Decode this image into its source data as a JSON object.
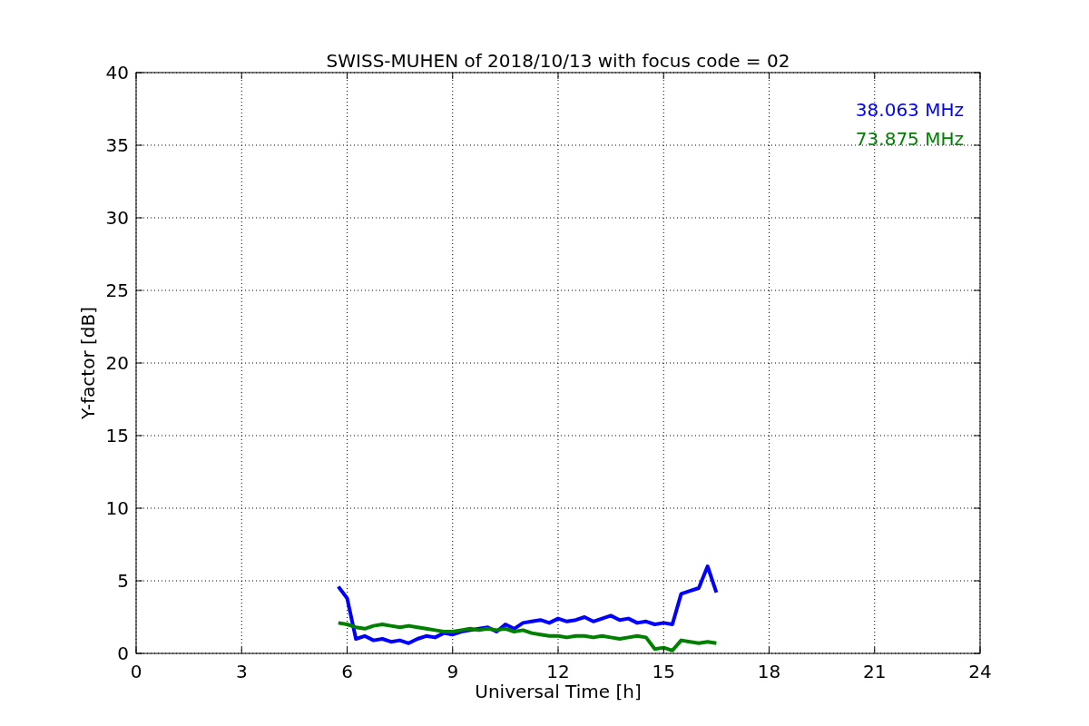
{
  "chart_data": {
    "type": "line",
    "title": "SWISS-MUHEN of 2018/10/13 with focus code = 02",
    "xlabel": "Universal Time [h]",
    "ylabel": "Y-factor [dB]",
    "x": [
      5.75,
      6,
      6.25,
      6.5,
      6.75,
      7,
      7.25,
      7.5,
      7.75,
      8,
      8.25,
      8.5,
      8.75,
      9,
      9.25,
      9.5,
      9.75,
      10,
      10.25,
      10.5,
      10.75,
      11,
      11.25,
      11.5,
      11.75,
      12,
      12.25,
      12.5,
      12.75,
      13,
      13.25,
      13.5,
      13.75,
      14,
      14.25,
      14.5,
      14.75,
      15,
      15.25,
      15.5,
      15.75,
      16,
      16.25,
      16.5
    ],
    "series": [
      {
        "name": "38.063 MHz",
        "color": "#0000ff",
        "values": [
          4.6,
          3.8,
          1.0,
          1.2,
          0.9,
          1.0,
          0.8,
          0.9,
          0.7,
          1.0,
          1.2,
          1.1,
          1.4,
          1.3,
          1.5,
          1.6,
          1.7,
          1.8,
          1.5,
          2.0,
          1.7,
          2.1,
          2.2,
          2.3,
          2.1,
          2.4,
          2.2,
          2.3,
          2.5,
          2.2,
          2.4,
          2.6,
          2.3,
          2.4,
          2.1,
          2.2,
          2.0,
          2.1,
          2.0,
          4.1,
          4.3,
          4.5,
          6.0,
          4.2
        ]
      },
      {
        "name": "73.875 MHz",
        "color": "#008000",
        "values": [
          2.1,
          2.0,
          1.8,
          1.7,
          1.9,
          2.0,
          1.9,
          1.8,
          1.9,
          1.8,
          1.7,
          1.6,
          1.5,
          1.5,
          1.6,
          1.7,
          1.6,
          1.7,
          1.6,
          1.7,
          1.5,
          1.6,
          1.4,
          1.3,
          1.2,
          1.2,
          1.1,
          1.2,
          1.2,
          1.1,
          1.2,
          1.1,
          1.0,
          1.1,
          1.2,
          1.1,
          0.3,
          0.4,
          0.2,
          0.9,
          0.8,
          0.7,
          0.8,
          0.7
        ]
      }
    ],
    "grid": true,
    "xlim": [
      0,
      24
    ],
    "ylim": [
      0,
      40
    ],
    "xticks": [
      0,
      3,
      6,
      9,
      12,
      15,
      18,
      21,
      24
    ],
    "yticks": [
      0,
      5,
      10,
      15,
      20,
      25,
      30,
      35,
      40
    ]
  }
}
